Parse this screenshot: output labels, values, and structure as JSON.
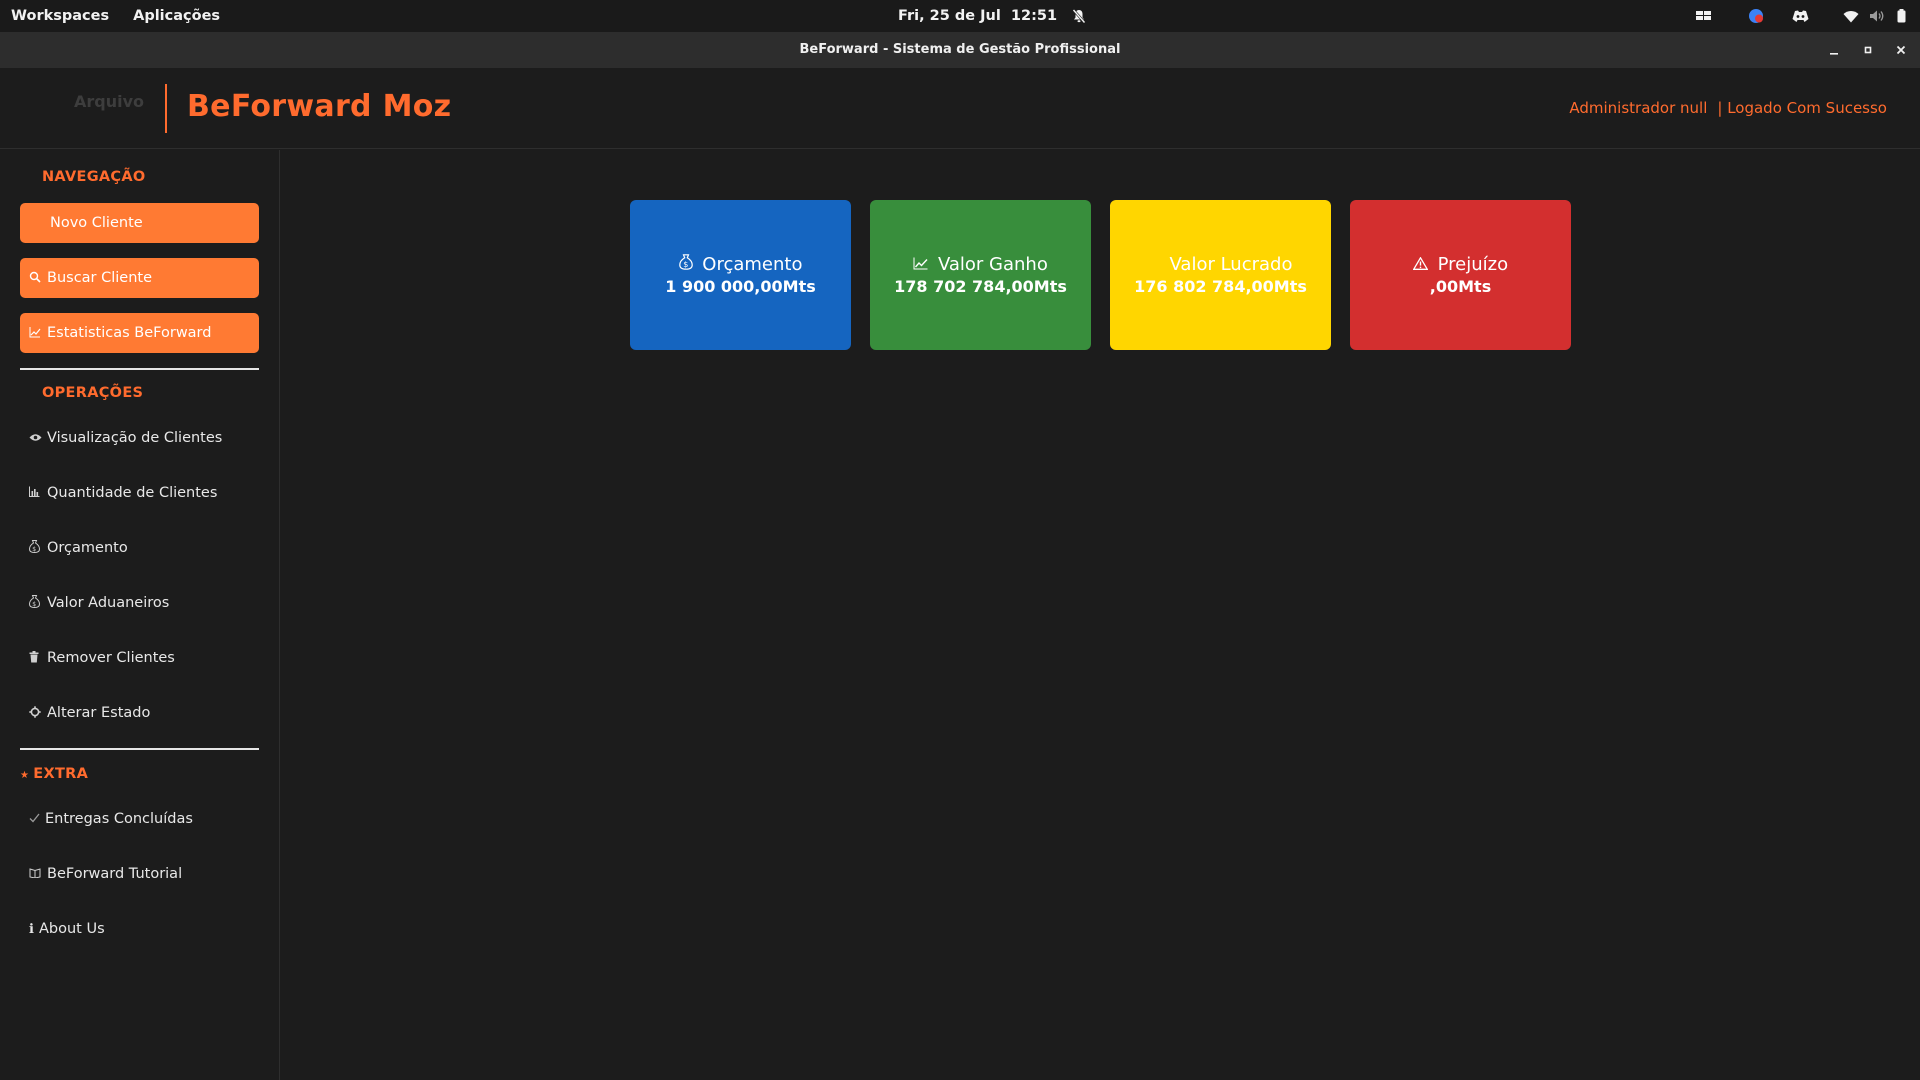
{
  "topbar": {
    "workspaces": "Workspaces",
    "applications": "Aplicações",
    "datetime": "Fri, 25 de Jul  12:51",
    "icons": [
      "notifications-muted-icon",
      "workspace-switcher-icon",
      "browser-icon",
      "discord-icon",
      "wifi-icon",
      "volume-icon",
      "battery-icon"
    ]
  },
  "window": {
    "title": "BeForward - Sistema de Gestão Profissional"
  },
  "header": {
    "menu_file": "Arquivo",
    "brand": "BeForward Moz",
    "user": "Administrador null",
    "status": "| Logado Com Sucesso",
    "accent_color": "#ff6b2e"
  },
  "sidebar": {
    "navigation_title": "NAVEGAÇÃO",
    "navigation": [
      {
        "icon": "add-user-icon",
        "label": "Novo Cliente"
      },
      {
        "icon": "search-icon",
        "label": "Buscar Cliente"
      },
      {
        "icon": "chart-icon",
        "label": "Estatisticas BeForward"
      }
    ],
    "operations_title": "OPERAÇÕES",
    "operations": [
      {
        "icon": "eye-icon",
        "label": "Visualização de Clientes"
      },
      {
        "icon": "bar-chart-icon",
        "label": "Quantidade de Clientes"
      },
      {
        "icon": "money-bag-icon",
        "label": "Orçamento"
      },
      {
        "icon": "money-bag-icon",
        "label": "Valor Aduaneiros"
      },
      {
        "icon": "trash-icon",
        "label": "Remover Clientes"
      },
      {
        "icon": "gear-icon",
        "label": "Alterar Estado"
      }
    ],
    "extra_title": "EXTRA",
    "extra": [
      {
        "icon": "check-icon",
        "label": "Entregas Concluídas"
      },
      {
        "icon": "book-icon",
        "label": "BeForward Tutorial"
      },
      {
        "icon": "info-icon",
        "label": "About Us"
      }
    ]
  },
  "cards": [
    {
      "icon": "money-bag-icon",
      "label": "Orçamento",
      "value": "1 900 000,00Mts",
      "color": "#1565c0"
    },
    {
      "icon": "chart-up-icon",
      "label": "Valor Ganho",
      "value": "178 702 784,00Mts",
      "color": "#388e3c"
    },
    {
      "icon": "money-icon",
      "label": "Valor Lucrado",
      "value": "176 802 784,00Mts",
      "color": "#ffd600"
    },
    {
      "icon": "warning-icon",
      "label": "Prejuízo",
      "value": ",00Mts",
      "color": "#d32f2f"
    }
  ]
}
